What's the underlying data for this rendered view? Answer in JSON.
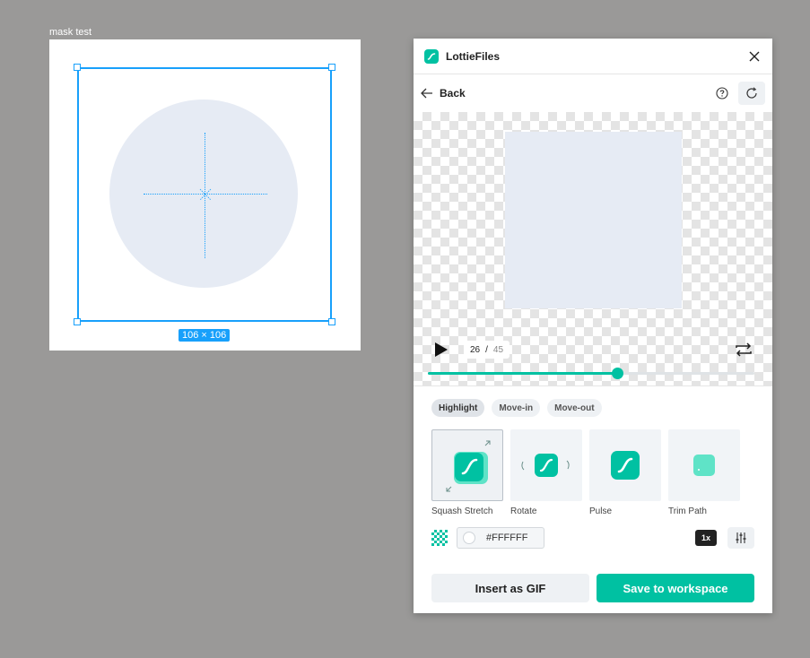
{
  "canvas": {
    "frame_label": "mask test",
    "dimensions_badge": "106 × 106",
    "selection_color": "#18a0fb",
    "shape_color": "#e6ebf4"
  },
  "plugin": {
    "title": "LottieFiles",
    "brand_color": "#00c1a2",
    "nav": {
      "back_label": "Back"
    },
    "player": {
      "current_frame": "26",
      "separator": "/",
      "total_frames": "45",
      "progress_fraction": 0.58
    },
    "tabs": [
      {
        "label": "Highlight",
        "active": true
      },
      {
        "label": "Move-in",
        "active": false
      },
      {
        "label": "Move-out",
        "active": false
      }
    ],
    "animations": [
      {
        "label": "Squash Stretch",
        "icon": "squash-stretch-icon",
        "selected": true
      },
      {
        "label": "Rotate",
        "icon": "rotate-icon",
        "selected": false
      },
      {
        "label": "Pulse",
        "icon": "pulse-icon",
        "selected": false
      },
      {
        "label": "Trim Path",
        "icon": "trim-path-icon",
        "selected": false
      }
    ],
    "background_color": {
      "value": "#FFFFFF"
    },
    "speed_label": "1x",
    "buttons": {
      "insert_gif": "Insert as GIF",
      "save_workspace": "Save to workspace"
    }
  }
}
